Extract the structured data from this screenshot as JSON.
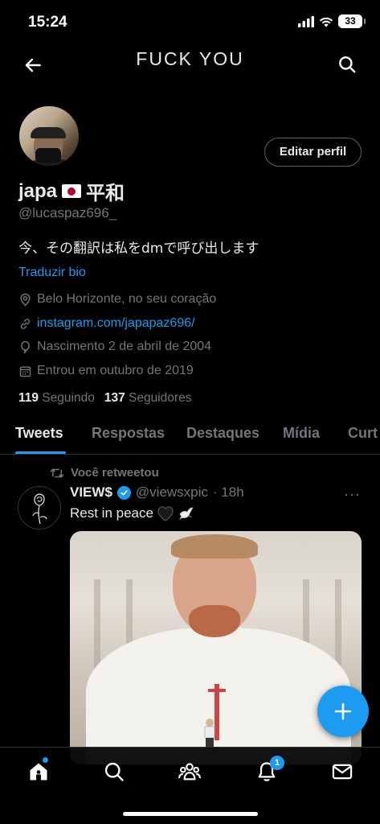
{
  "status_bar": {
    "time": "15:24",
    "battery": "33"
  },
  "header": {
    "title": "FUCK YOU"
  },
  "profile": {
    "edit_button": "Editar perfil",
    "display_name": "japa",
    "display_name_suffix": "平和",
    "handle": "@lucaspaz696_",
    "bio": "今、その翻訳は私をdmで呼び出します",
    "translate_bio": "Traduzir bio",
    "location": "Belo Horizonte, no seu coração",
    "website": "instagram.com/japapaz696/",
    "birthday": "Nascimento 2 de abril de 2004",
    "joined": "Entrou em outubro de 2019",
    "following_count": "119",
    "following_label": "Seguindo",
    "followers_count": "137",
    "followers_label": "Seguidores"
  },
  "tabs": [
    {
      "label": "Tweets",
      "active": true
    },
    {
      "label": "Respostas"
    },
    {
      "label": "Destaques"
    },
    {
      "label": "Mídia"
    },
    {
      "label": "Curt"
    }
  ],
  "tweet": {
    "retweet_label": "Você retweetou",
    "author": "VIEW$",
    "handle": "@viewsxpic",
    "time": "· 18h",
    "more": "···",
    "text": "Rest in peace"
  },
  "bottom_nav": {
    "notification_count": "1"
  },
  "colors": {
    "accent": "#1d9bf0",
    "muted": "#71767b",
    "text": "#e7e9ea",
    "background": "#000000"
  }
}
